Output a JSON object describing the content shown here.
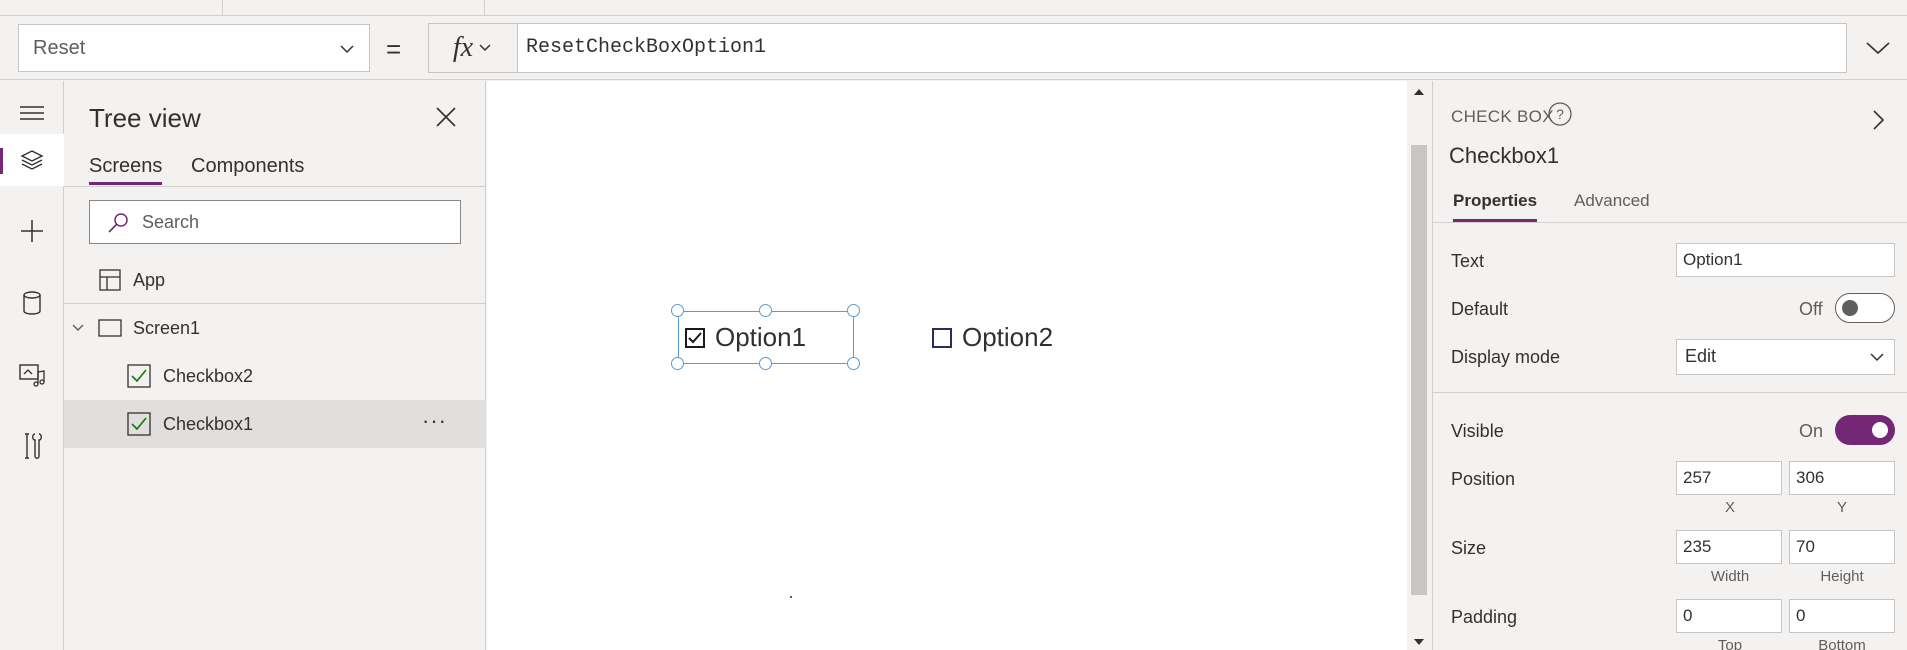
{
  "formula_bar": {
    "property": "Reset",
    "equals": "=",
    "fx_label": "fx",
    "formula": "ResetCheckBoxOption1"
  },
  "rail": {
    "items": [
      "menu-icon",
      "layers-icon",
      "plus-icon",
      "database-icon",
      "media-icon",
      "tools-icon"
    ],
    "active": "layers-icon"
  },
  "tree": {
    "title": "Tree view",
    "tabs": [
      "Screens",
      "Components"
    ],
    "active_tab": "Screens",
    "search_placeholder": "Search",
    "app_label": "App",
    "screen_label": "Screen1",
    "items": [
      {
        "label": "Checkbox2",
        "selected": false
      },
      {
        "label": "Checkbox1",
        "selected": true
      }
    ],
    "more_label": "···"
  },
  "canvas": {
    "checkbox1": {
      "label": "Option1",
      "checked": true
    },
    "checkbox2": {
      "label": "Option2",
      "checked": false
    }
  },
  "panel": {
    "control_type": "CHECK BOX",
    "control_name": "Checkbox1",
    "tabs": [
      "Properties",
      "Advanced"
    ],
    "active_tab": "Properties",
    "text_label": "Text",
    "text_value": "Option1",
    "default_label": "Default",
    "default_state": "Off",
    "display_mode_label": "Display mode",
    "display_mode_value": "Edit",
    "visible_label": "Visible",
    "visible_state": "On",
    "position_label": "Position",
    "position_x": "257",
    "position_y": "306",
    "x_label": "X",
    "y_label": "Y",
    "size_label": "Size",
    "size_width": "235",
    "size_height": "70",
    "width_label": "Width",
    "height_label": "Height",
    "padding_label": "Padding",
    "padding_top": "0",
    "padding_bottom": "0",
    "top_label": "Top",
    "bottom_label": "Bottom"
  },
  "colors": {
    "accent": "#742774",
    "selection": "#5b9bd5",
    "panel_bg": "#f3f2f1"
  }
}
